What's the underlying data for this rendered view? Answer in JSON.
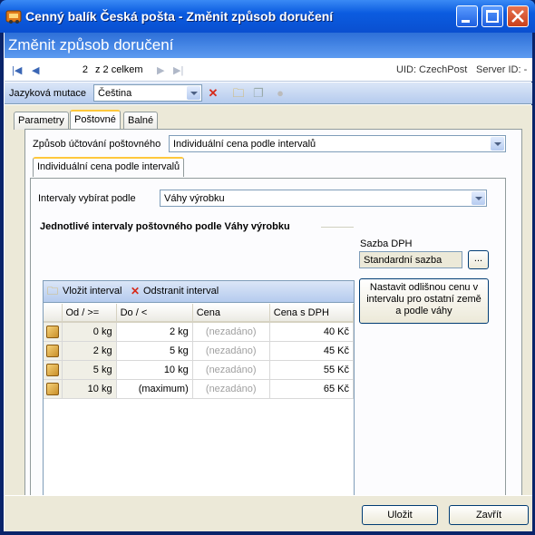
{
  "window": {
    "title": "Cenný balík Česká pošta - Změnit způsob doručení"
  },
  "header": {
    "title": "Změnit způsob doručení"
  },
  "nav": {
    "page": "2",
    "total": "z 2 celkem",
    "uid": "UID: CzechPost",
    "server": "Server ID: -"
  },
  "toolbar": {
    "lang_label": "Jazyková mutace",
    "lang_value": "Čeština"
  },
  "tabs": [
    "Parametry",
    "Poštovné",
    "Balné"
  ],
  "billing": {
    "label": "Způsob účtování poštovného",
    "value": "Individuální cena podle intervalů"
  },
  "subtab": "Individuální cena podle intervalů",
  "intervals": {
    "label": "Intervaly vybírat podle",
    "value": "Váhy výrobku"
  },
  "section_title": "Jednotlivé intervaly poštovného podle Váhy výrobku",
  "grid": {
    "add_label": "Vložit interval",
    "remove_label": "Odstranit interval",
    "columns": [
      "Od / >=",
      "Do / <",
      "Cena",
      "Cena s DPH"
    ],
    "rows": [
      [
        "0 kg",
        "2 kg",
        "(nezadáno)",
        "40 Kč"
      ],
      [
        "2 kg",
        "5 kg",
        "(nezadáno)",
        "45 Kč"
      ],
      [
        "5 kg",
        "10 kg",
        "(nezadáno)",
        "55 Kč"
      ],
      [
        "10 kg",
        "(maximum)",
        "(nezadáno)",
        "65 Kč"
      ]
    ]
  },
  "vat": {
    "label": "Sazba DPH",
    "value": "Standardní sazba",
    "browse": "..."
  },
  "other_price_button": "Nastavit odlišnou cenu v intervalu pro ostatní země a podle váhy",
  "buttons": {
    "save": "Uložit",
    "close": "Zavřít"
  }
}
